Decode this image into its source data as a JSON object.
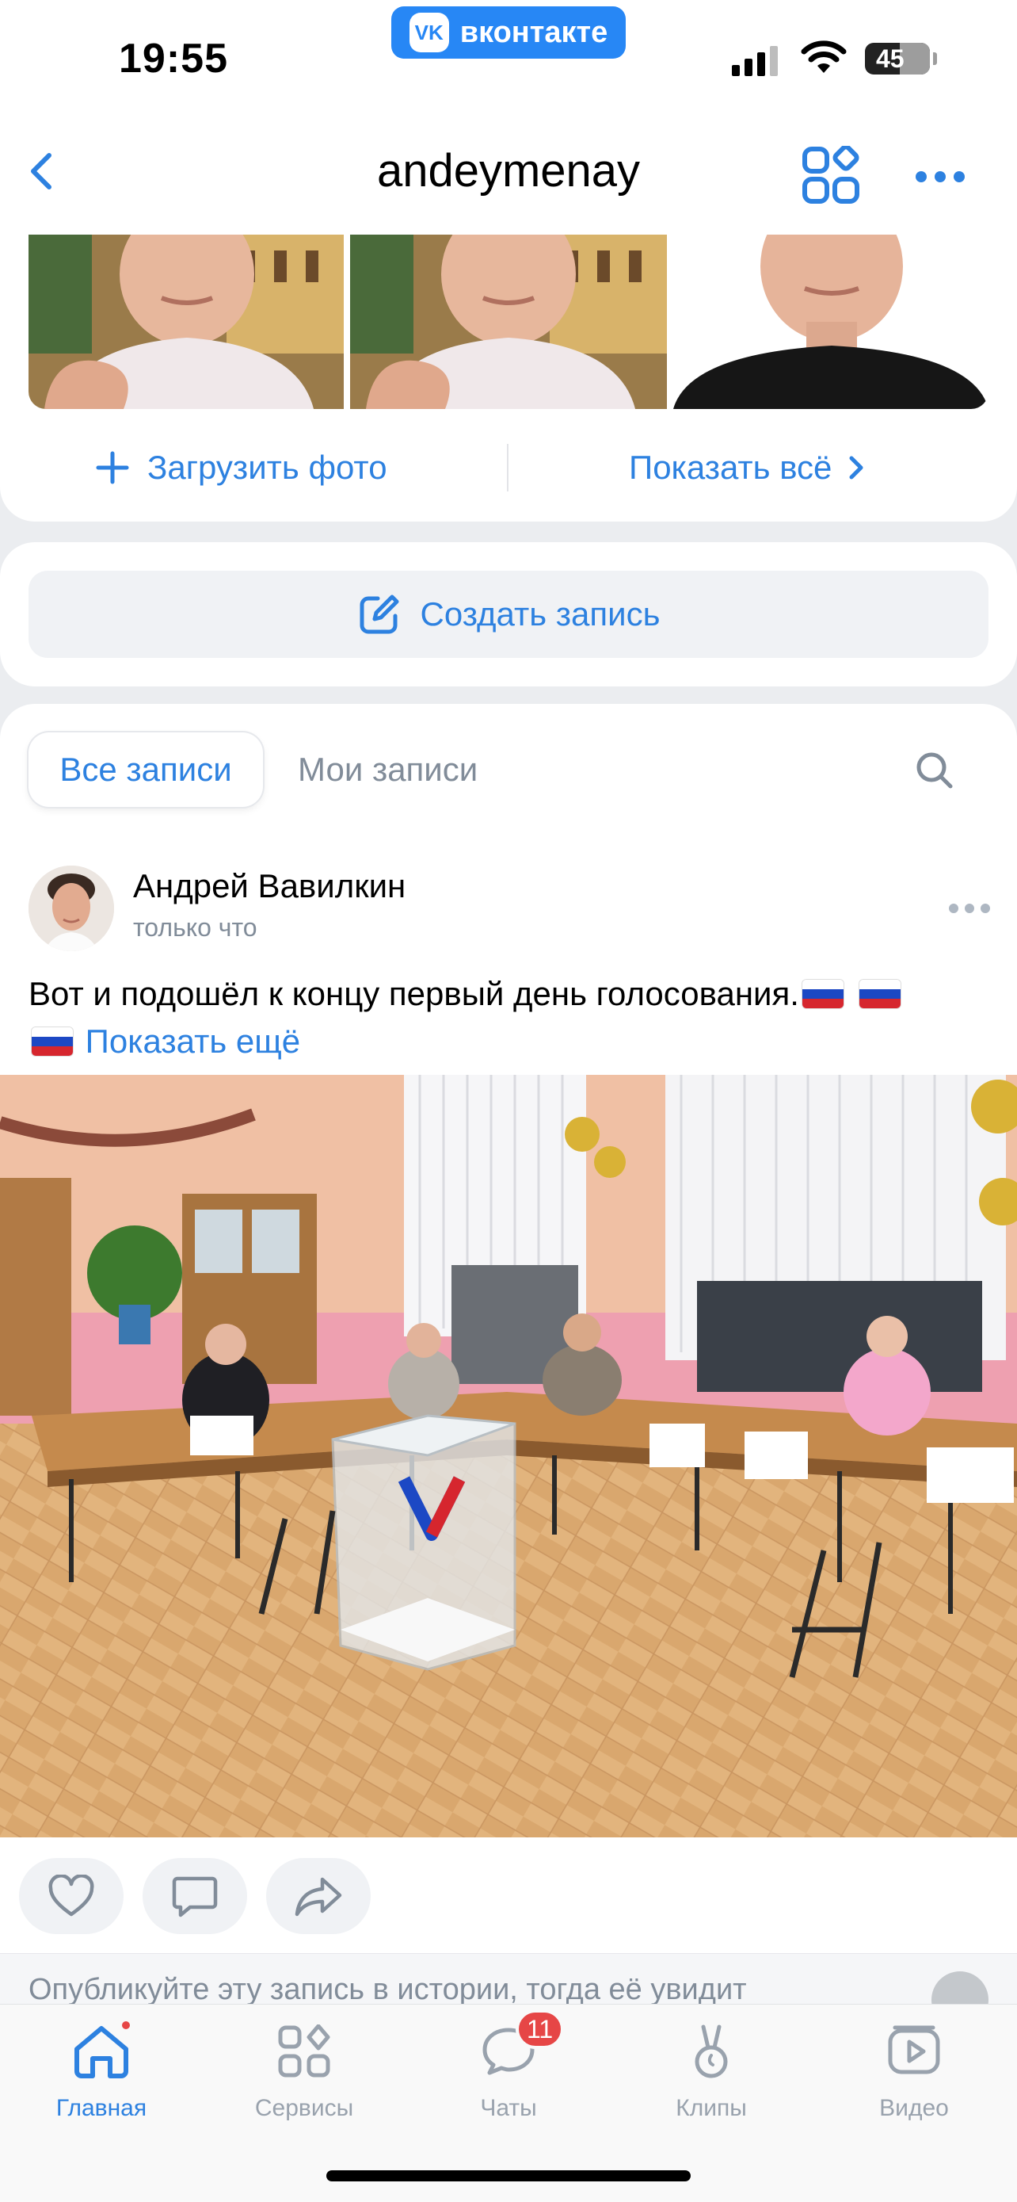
{
  "status_bar": {
    "time": "19:55",
    "app_badge": "вконтакте",
    "vk_logo": "VK",
    "battery": "45"
  },
  "nav": {
    "title": "andeymenay"
  },
  "photos": {
    "upload_label": "Загрузить фото",
    "show_all_label": "Показать всё"
  },
  "create_post": {
    "label": "Создать запись"
  },
  "feed": {
    "tabs": [
      {
        "label": "Все записи",
        "active": true
      },
      {
        "label": "Мои записи",
        "active": false
      }
    ]
  },
  "post": {
    "author": "Андрей Вавилкин",
    "time": "только что",
    "text": "Вот и подошёл к концу первый день голосования.",
    "more_link": "Показать ещё"
  },
  "story_hint": {
    "text": "Опубликуйте эту запись в истории, тогда её увидит"
  },
  "tabbar": {
    "items": [
      {
        "label": "Главная",
        "icon": "home-icon",
        "active": true
      },
      {
        "label": "Сервисы",
        "icon": "services-icon",
        "active": false
      },
      {
        "label": "Чаты",
        "icon": "chats-icon",
        "active": false,
        "badge": "11"
      },
      {
        "label": "Клипы",
        "icon": "clips-icon",
        "active": false
      },
      {
        "label": "Видео",
        "icon": "video-icon",
        "active": false
      }
    ]
  },
  "colors": {
    "accent": "#2d81e0",
    "vk_brand": "#2787f5",
    "badge": "#e64646",
    "secondary_text": "#818c99"
  }
}
